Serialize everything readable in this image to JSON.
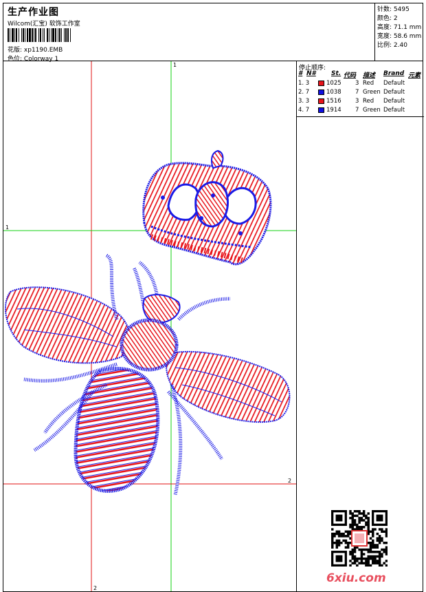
{
  "header": {
    "title": "生产作业图",
    "company": "Wilcom(汇宝) 软饰工作室",
    "design_label": "花版:",
    "design_value": "xp1190.EMB",
    "color_label": "色位:",
    "color_value": "Colorway 1"
  },
  "stats": {
    "stitches": "针数: 5495",
    "colors": "颜色: 2",
    "height": "高度: 71.1 mm",
    "width": "宽度: 58.6 mm",
    "scale": "比例: 2.40"
  },
  "guides": {
    "v1": "1",
    "h1": "1",
    "h2": "2",
    "v2": "2"
  },
  "stop_sequence": {
    "title": "停止顺序:",
    "headers": {
      "num": "#",
      "n": "N#",
      "st": "St.",
      "code": "代码",
      "desc": "描述",
      "brand": "Brand",
      "elem": "元素"
    },
    "rows": [
      {
        "idx": "1. 3",
        "st": "1025",
        "code": "3",
        "desc": "Red",
        "brand": "Default",
        "color": "#e8141b"
      },
      {
        "idx": "2. 7",
        "st": "1038",
        "code": "7",
        "desc": "Green",
        "brand": "Default",
        "color": "#1010e0"
      },
      {
        "idx": "3. 3",
        "st": "1516",
        "code": "3",
        "desc": "Red",
        "brand": "Default",
        "color": "#e8141b"
      },
      {
        "idx": "4. 7",
        "st": "1914",
        "code": "7",
        "desc": "Green",
        "brand": "Default",
        "color": "#1010e0"
      }
    ]
  },
  "colors": {
    "red_thread": "#e8141b",
    "blue_thread": "#1a1ae6",
    "guide_red": "#e01010",
    "guide_green": "#10d010"
  },
  "watermark": "6xiu.com"
}
